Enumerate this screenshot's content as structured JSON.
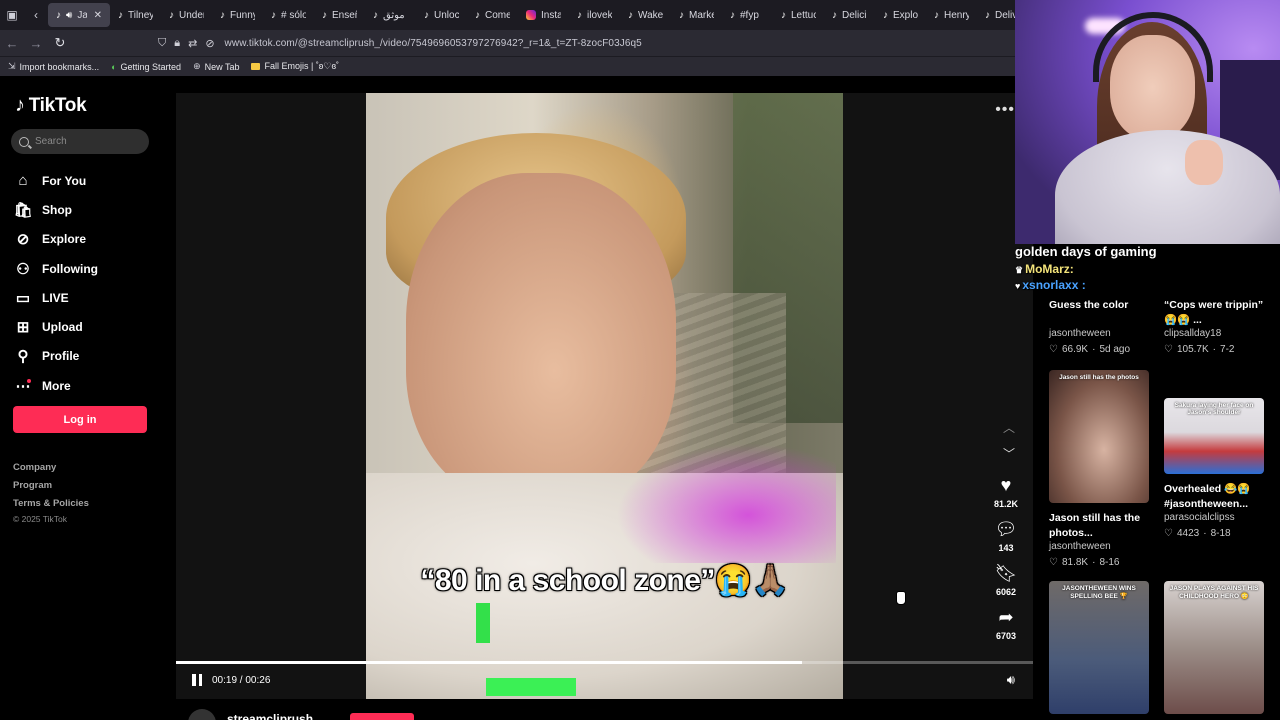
{
  "browser": {
    "tabs": [
      {
        "label": "Jas",
        "active": true
      },
      {
        "label": "Tilney"
      },
      {
        "label": "Under"
      },
      {
        "label": "Funny"
      },
      {
        "label": "# sólo"
      },
      {
        "label": "Enseñ"
      },
      {
        "label": "موثق"
      },
      {
        "label": "Unloc"
      },
      {
        "label": "Come"
      },
      {
        "label": "Instag",
        "icon": "instagram"
      },
      {
        "label": "ilovek"
      },
      {
        "label": "Wake"
      },
      {
        "label": "Marke"
      },
      {
        "label": "#fyp"
      },
      {
        "label": "Lettuc"
      },
      {
        "label": "Delici"
      },
      {
        "label": "Explor"
      },
      {
        "label": "Henry"
      },
      {
        "label": "Deliv"
      }
    ],
    "url": "www.tiktok.com/@streamcliprush_/video/7549696053797276942?_r=1&_t=ZT-8zocF03J6q5",
    "bookmarks": [
      "Import bookmarks...",
      "Getting Started",
      "New Tab",
      "Fall Emojis | ˚ʚ♡ɞ˚"
    ]
  },
  "sidebar": {
    "logo_text": "TikTok",
    "search_placeholder": "Search",
    "nav": [
      {
        "label": "For You",
        "icon": "home-icon"
      },
      {
        "label": "Shop",
        "icon": "shop-icon"
      },
      {
        "label": "Explore",
        "icon": "compass-icon"
      },
      {
        "label": "Following",
        "icon": "following-icon"
      },
      {
        "label": "LIVE",
        "icon": "live-icon"
      },
      {
        "label": "Upload",
        "icon": "upload-icon"
      },
      {
        "label": "Profile",
        "icon": "profile-icon"
      },
      {
        "label": "More",
        "icon": "more-icon"
      }
    ],
    "login_label": "Log in",
    "footer": [
      "Company",
      "Program",
      "Terms & Policies"
    ],
    "copyright": "© 2025 TikTok"
  },
  "player": {
    "caption": "“80 in a school zone”😭🙏🏽",
    "likes": "81.2K",
    "comments": "143",
    "saves": "6062",
    "shares": "6703",
    "time": "00:19 / 00:26",
    "progress_fraction": 0.73,
    "username": "streamcliprush"
  },
  "overlay": {
    "chat": [
      {
        "text": "golden days of gaming"
      },
      {
        "text": "MoMarz:"
      },
      {
        "text": "xsnorlaxx :"
      }
    ]
  },
  "related": [
    {
      "title": "Guess the color",
      "author": "jasontheween",
      "likes": "66.9K",
      "date": "5d ago",
      "thumb_text": "",
      "bg": "linear-gradient(180deg,#c9b08a,#8a7058)"
    },
    {
      "title": "“Cops were trippin” 😭😭 ...",
      "author": "clipsallday18",
      "likes": "105.7K",
      "date": "7-2",
      "thumb_text": "",
      "bg": "linear-gradient(180deg,#8e8478,#5d5148)"
    },
    {
      "title": "Jason still has the photos...",
      "author": "jasontheween",
      "likes": "81.8K",
      "date": "8-16",
      "thumb_text": "Jason still has the photos",
      "bg": "radial-gradient(ellipse at 55% 60%,#d7b3a2,#7a5548 60%,#3a2622)"
    },
    {
      "title": "Overhealed 😂😭 #jasontheween...",
      "author": "parasocialclipss",
      "likes": "4423",
      "date": "8-18",
      "thumb_text": "Sakura laying her face on Jason's shoulder",
      "bg": "linear-gradient(180deg,#e8e6ea 0%,#dcd9de 45%,#c53b3e 70%,#2b6fd6 100%)"
    },
    {
      "title": "",
      "author": "",
      "likes": "",
      "date": "",
      "thumb_text": "JASONTHEWEEN WINS SPELLING BEE 🏆",
      "bg": "linear-gradient(180deg,#6f6a68,#4b5b7a 60%,#2f3f6a)"
    },
    {
      "title": "",
      "author": "",
      "likes": "",
      "date": "",
      "thumb_text": "JASON PLAYS AGAINST HIS CHILDHOOD HERO 😳",
      "bg": "linear-gradient(180deg,#d8d2d0,#9c8e88 50%,#6d4d4a)"
    }
  ]
}
